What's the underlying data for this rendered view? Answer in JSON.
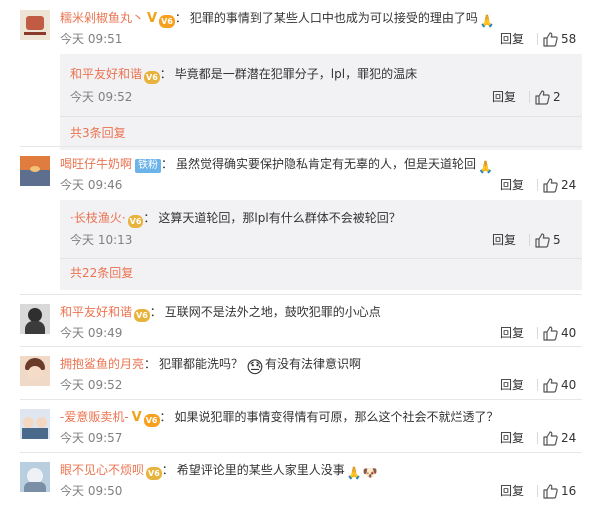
{
  "comments": [
    {
      "user": "糯米剁椒鱼丸丶",
      "text": "犯罪的事情到了某些人口中也成为可以接受的理由了吗",
      "time": "今天 09:51",
      "reply_label": "回复",
      "likes": "58",
      "avatar_colors": [
        "#ede4d6",
        "#c25b43"
      ]
    },
    {
      "user": "喝旺仔牛奶啊",
      "badge": "铁粉",
      "text": "虽然觉得确实要保护隐私肯定有无辜的人，但是天道轮回",
      "time": "今天 09:46",
      "reply_label": "回复",
      "likes": "24",
      "avatar_colors": [
        "#e07c3e",
        "#5d6e8f"
      ]
    },
    {
      "user": "和平友好和谐",
      "text": "互联网不是法外之地，鼓吹犯罪的小心点",
      "time": "今天 09:49",
      "reply_label": "回复",
      "likes": "40",
      "avatar_colors": [
        "#d9d9d9",
        "#2f2f2f"
      ]
    },
    {
      "user": "拥抱鲨鱼的月亮",
      "text_before": "犯罪都能洗吗？",
      "text_after": "有没有法律意识啊",
      "time": "今天 09:52",
      "reply_label": "回复",
      "likes": "40",
      "avatar_colors": [
        "#f0d9c7",
        "#6b3b2a"
      ]
    },
    {
      "user": "-爱意贩卖机-",
      "text": "如果说犯罪的事情变得情有可原，那么这个社会不就烂透了？",
      "time": "今天 09:57",
      "reply_label": "回复",
      "likes": "24",
      "avatar_colors": [
        "#dfe6ef",
        "#4a6a8c"
      ]
    },
    {
      "user": "眼不见心不烦呗",
      "text": "希望评论里的某些人家里人没事",
      "time": "今天 09:50",
      "reply_label": "回复",
      "likes": "16",
      "avatar_colors": [
        "#b9cfe0",
        "#7a8fa6"
      ]
    }
  ],
  "subreplies": [
    {
      "user": "和平友好和谐",
      "text": "毕竟都是一群潜在犯罪分子，lpl，罪犯的温床",
      "time": "今天 09:52",
      "reply_label": "回复",
      "likes": "2",
      "more": "共3条回复"
    },
    {
      "user": "·长枝渔火·",
      "text": "这算天道轮回，那lpl有什么群体不会被轮回？",
      "time": "今天 10:13",
      "reply_label": "回复",
      "likes": "5",
      "more": "共22条回复"
    }
  ],
  "icons": {
    "v_badge": "V",
    "vip_badge": "V6",
    "pray_emoji": "🙏",
    "sweat_emoji": "😓",
    "doge_emoji": "🐶",
    "thumb": "thumb-up-icon"
  },
  "colors": {
    "username": "#eb7350",
    "muted": "#808080",
    "reply_bg": "#f2f2f5"
  }
}
